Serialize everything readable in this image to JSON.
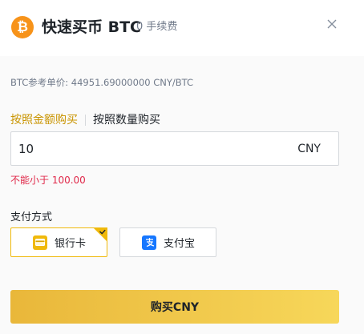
{
  "header": {
    "coin_icon": "bitcoin-icon",
    "coin_symbol": "₿",
    "title": "快速买币 BTC",
    "fee_text": "0 手续费",
    "close_icon": "close-icon"
  },
  "reference_price": "BTC参考单价: 44951.69000000 CNY/BTC",
  "tabs": [
    {
      "label": "按照金额购买",
      "active": true
    },
    {
      "label": "按照数量购买",
      "active": false
    }
  ],
  "amount_input": {
    "value": "10",
    "unit": "CNY"
  },
  "error_message": "不能小于 100.00",
  "payment": {
    "label": "支付方式",
    "methods": [
      {
        "name": "银行卡",
        "icon": "bank-card-icon",
        "selected": true
      },
      {
        "name": "支付宝",
        "icon": "alipay-icon",
        "selected": false
      }
    ]
  },
  "buy_button": {
    "label": "购买CNY"
  },
  "colors": {
    "accent": "#f0b90b",
    "active_tab": "#c99400",
    "error": "#e0294a",
    "bitcoin": "#f7931a",
    "alipay": "#1677ff"
  }
}
